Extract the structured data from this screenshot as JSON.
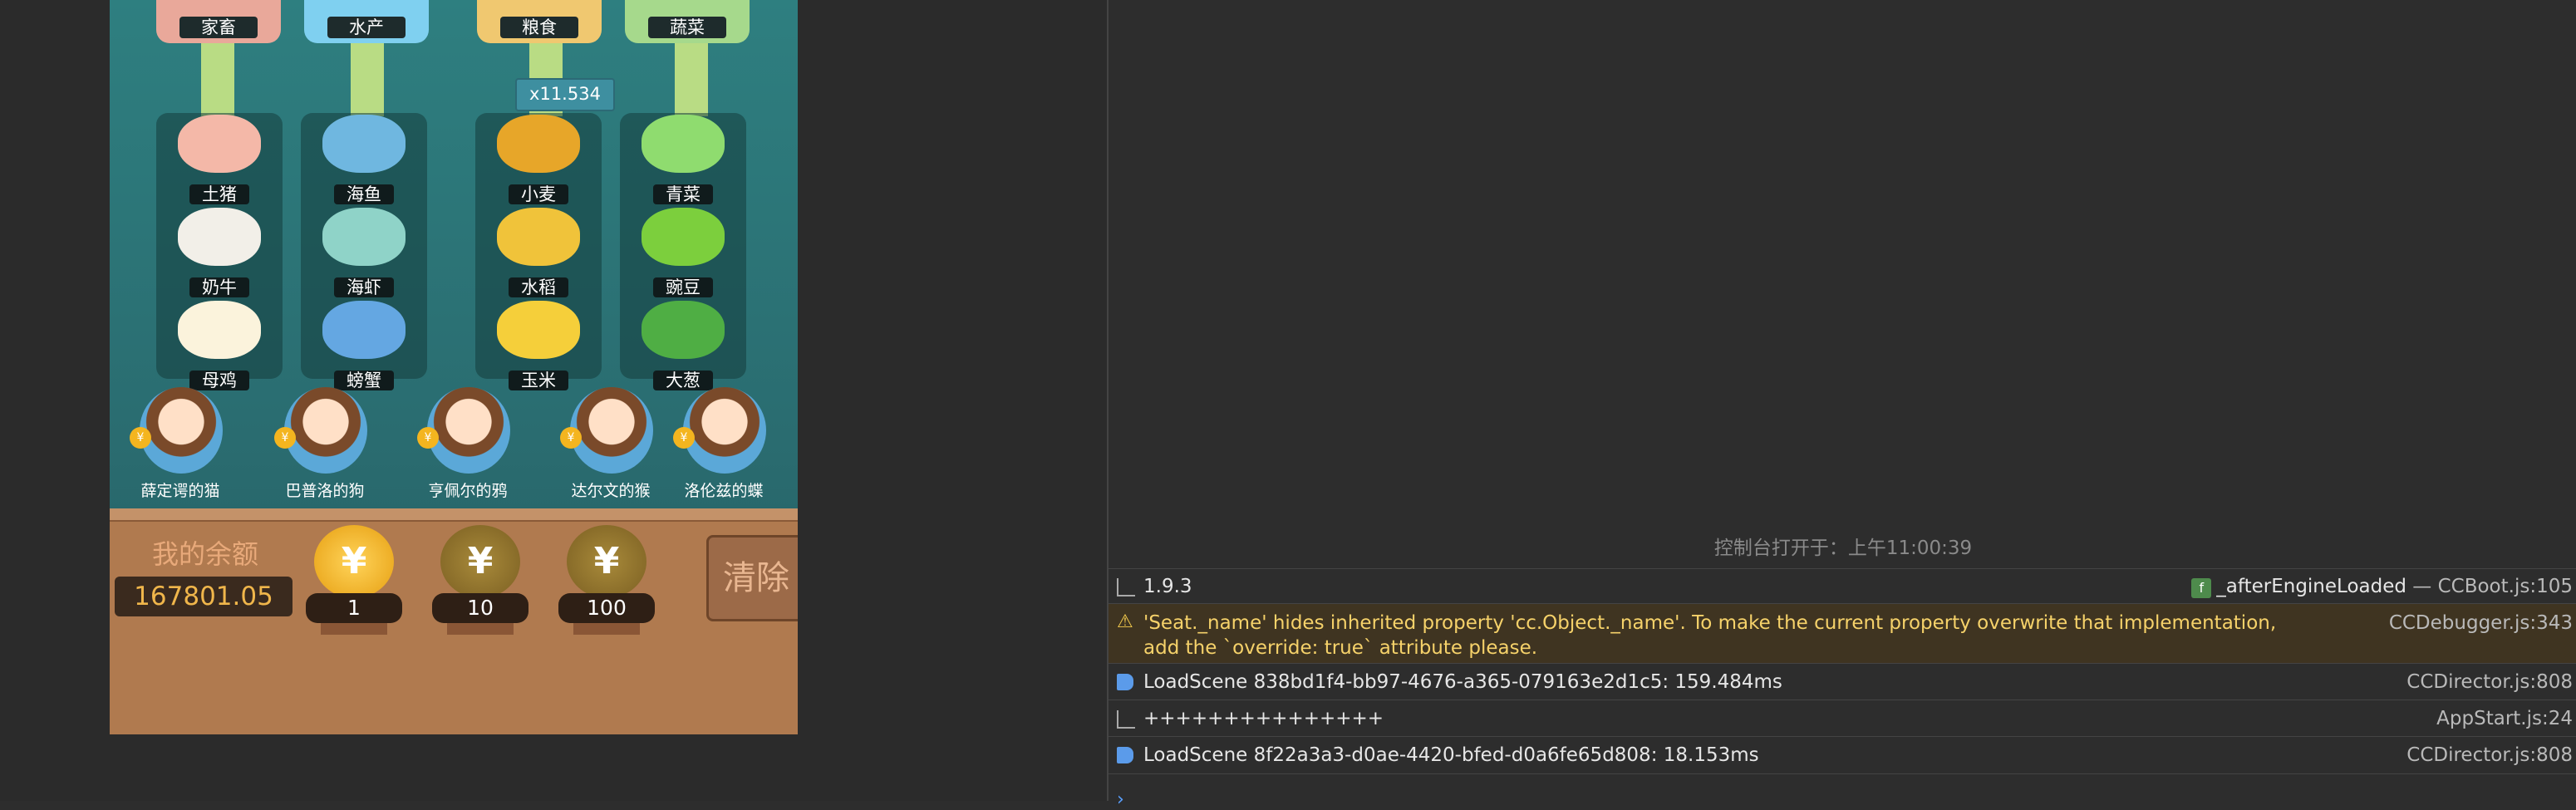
{
  "game": {
    "categories": [
      "家畜",
      "水产",
      "粮食",
      "蔬菜"
    ],
    "multiplier": "x11.534",
    "columns": [
      [
        "土猪",
        "奶牛",
        "母鸡"
      ],
      [
        "海鱼",
        "海虾",
        "螃蟹"
      ],
      [
        "小麦",
        "水稻",
        "玉米"
      ],
      [
        "青菜",
        "豌豆",
        "大葱"
      ]
    ],
    "agents": [
      "薛定谔的猫",
      "巴普洛的狗",
      "亨佩尔的鸦",
      "达尔文的猴",
      "洛伦兹的蝶"
    ],
    "balance_label": "我的余额",
    "balance_value": "167801.05",
    "chips": [
      "1",
      "10",
      "100"
    ],
    "chip_symbol": "¥",
    "clear_label": "清除"
  },
  "console": {
    "opened": "控制台打开于：上午11:00:39",
    "rows": [
      {
        "msg": "1.9.3",
        "fn": "_afterEngineLoaded",
        "src": "— CCBoot.js:105"
      },
      {
        "msg": "'Seat._name' hides inherited property 'cc.Object._name'. To make the current property overwrite that implementation, add the `override: true` attribute please.",
        "src": "CCDebugger.js:343"
      },
      {
        "msg": "LoadScene 838bd1f4-bb97-4676-a365-079163e2d1c5: 159.484ms",
        "src": "CCDirector.js:808"
      },
      {
        "msg": "+++++++++++++++",
        "src": "AppStart.js:24"
      },
      {
        "msg": "LoadScene 8f22a3a3-d0ae-4420-bfed-d0a6fe65d808: 18.153ms",
        "src": "CCDirector.js:808"
      }
    ],
    "prompt": "›"
  }
}
